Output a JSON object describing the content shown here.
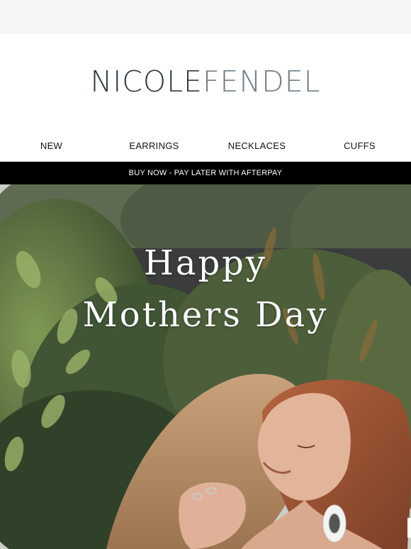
{
  "brand": {
    "part1": "NICOLE",
    "part2": "FENDEL"
  },
  "nav": {
    "items": [
      {
        "label": "NEW"
      },
      {
        "label": "EARRINGS"
      },
      {
        "label": "NECKLACES"
      },
      {
        "label": "CUFFS"
      }
    ]
  },
  "promo": {
    "text": "BUY NOW - PAY LATER WITH AFTERPAY"
  },
  "hero": {
    "line1": "Happy",
    "line2": "Mothers Day"
  },
  "colors": {
    "logo_dark": "#2f3a44",
    "logo_light": "#6f7e8a",
    "promo_bg": "#000000"
  }
}
